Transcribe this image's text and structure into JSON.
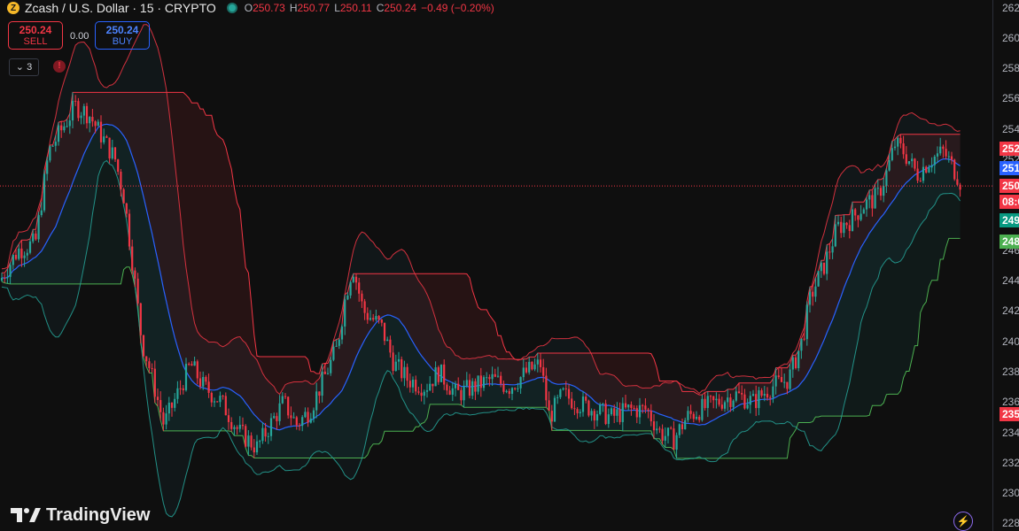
{
  "header": {
    "coin_glyph": "Z",
    "title": "Zcash / U.S. Dollar · 15 · CRYPTO",
    "ohlc": [
      {
        "label": "O",
        "value": "250.73"
      },
      {
        "label": "H",
        "value": "250.77"
      },
      {
        "label": "L",
        "value": "250.11"
      },
      {
        "label": "C",
        "value": "250.24"
      }
    ],
    "change": "−0.49 (−0.20%)"
  },
  "trade": {
    "sell_price": "250.24",
    "sell_label": "SELL",
    "spread": "0.00",
    "buy_price": "250.24",
    "buy_label": "BUY"
  },
  "indicators": {
    "collapse_label": "⌄ 3",
    "alert_glyph": "!"
  },
  "branding": {
    "logo_text": "TradingView"
  },
  "colors": {
    "up": "#26a69a",
    "down": "#f23645",
    "bb_upper": "#f23645",
    "bb_lower": "#26a69a",
    "basis": "#2962ff",
    "donchian": "#4caf50",
    "last_price": "#f23645"
  },
  "price_axis": {
    "ticks": [
      "262",
      "260",
      "258",
      "256",
      "254",
      "252",
      "250",
      "248",
      "246",
      "244",
      "242",
      "240",
      "238",
      "236",
      "234",
      "232",
      "230",
      "228"
    ],
    "boxes": [
      {
        "text": "252",
        "color": "#f23645",
        "price": 252.7
      },
      {
        "text": "251",
        "color": "#2962ff",
        "price": 251.4
      },
      {
        "text": "250",
        "color": "#f23645",
        "price": 250.24
      },
      {
        "text": "08:0",
        "color": "#f23645",
        "price": 249.2
      },
      {
        "text": "249",
        "color": "#089981",
        "price": 248.0
      },
      {
        "text": "248",
        "color": "#4caf50",
        "price": 246.6
      },
      {
        "text": "235",
        "color": "#f23645",
        "price": 235.2
      }
    ]
  },
  "chart_data": {
    "type": "candlestick",
    "symbol": "Zcash / U.S. Dollar",
    "interval": "15",
    "ylim": [
      227.5,
      262.5
    ],
    "last_price": 250.24,
    "close_path": [
      [
        0,
        244.0
      ],
      [
        20,
        246.0
      ],
      [
        40,
        246.5
      ],
      [
        55,
        252.5
      ],
      [
        70,
        254.0
      ],
      [
        85,
        255.5
      ],
      [
        100,
        255.0
      ],
      [
        115,
        253.5
      ],
      [
        130,
        252.0
      ],
      [
        140,
        249.5
      ],
      [
        150,
        245.0
      ],
      [
        160,
        240.0
      ],
      [
        170,
        238.0
      ],
      [
        185,
        234.5
      ],
      [
        200,
        236.5
      ],
      [
        215,
        238.5
      ],
      [
        230,
        237.0
      ],
      [
        250,
        236.0
      ],
      [
        270,
        234.0
      ],
      [
        290,
        233.0
      ],
      [
        305,
        234.5
      ],
      [
        320,
        236.0
      ],
      [
        335,
        234.5
      ],
      [
        350,
        235.5
      ],
      [
        365,
        237.5
      ],
      [
        380,
        239.5
      ],
      [
        390,
        243.0
      ],
      [
        398,
        245.0
      ],
      [
        410,
        242.0
      ],
      [
        430,
        241.0
      ],
      [
        445,
        238.5
      ],
      [
        460,
        237.5
      ],
      [
        480,
        237.0
      ],
      [
        495,
        238.0
      ],
      [
        515,
        236.5
      ],
      [
        535,
        237.0
      ],
      [
        555,
        237.5
      ],
      [
        575,
        237.0
      ],
      [
        595,
        238.0
      ],
      [
        610,
        238.5
      ],
      [
        620,
        235.0
      ],
      [
        635,
        236.5
      ],
      [
        650,
        236.0
      ],
      [
        670,
        235.5
      ],
      [
        690,
        235.0
      ],
      [
        710,
        235.5
      ],
      [
        730,
        235.5
      ],
      [
        745,
        234.0
      ],
      [
        760,
        233.5
      ],
      [
        775,
        235.0
      ],
      [
        790,
        235.5
      ],
      [
        810,
        236.0
      ],
      [
        830,
        236.5
      ],
      [
        850,
        236.0
      ],
      [
        870,
        237.0
      ],
      [
        890,
        237.5
      ],
      [
        905,
        240.0
      ],
      [
        915,
        243.0
      ],
      [
        930,
        245.0
      ],
      [
        945,
        247.5
      ],
      [
        960,
        248.0
      ],
      [
        975,
        249.0
      ],
      [
        990,
        249.5
      ],
      [
        1000,
        251.0
      ],
      [
        1010,
        253.0
      ],
      [
        1020,
        252.5
      ],
      [
        1035,
        251.0
      ],
      [
        1050,
        252.0
      ],
      [
        1065,
        252.5
      ],
      [
        1080,
        251.0
      ],
      [
        1086,
        250.24
      ]
    ]
  }
}
